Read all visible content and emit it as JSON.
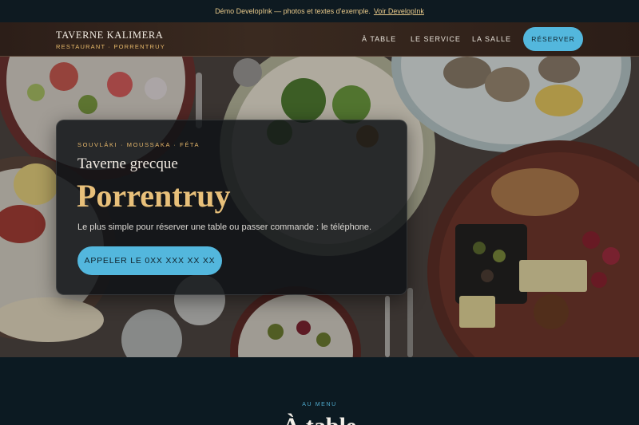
{
  "demo_bar": {
    "text": "Démo DevelopInk — photos et textes d'exemple.",
    "link": "Voir DevelopInk"
  },
  "brand": {
    "name": "TAVERNE KALIMERA",
    "subtitle": "RESTAURANT · PORRENTRUY"
  },
  "nav": {
    "items": [
      {
        "label": "À TABLE"
      },
      {
        "label": "LE SERVICE"
      },
      {
        "label": "LA SALLE"
      }
    ],
    "cta": "RÉSERVER"
  },
  "hero": {
    "kicker": "SOUVLÁKI · MOUSSAKA · FÉTA",
    "subtitle": "Taverne grecque",
    "title": "Porrentruy",
    "lead": "Le plus simple pour réserver une table ou passer commande : le téléphone.",
    "cta": "APPELER LE 0XX XXX XX XX"
  },
  "menu_section": {
    "kicker": "AU MENU",
    "title": "À table"
  },
  "colors": {
    "accent": "#53b7dd",
    "gold": "#e8c07a",
    "background": "#0b1820"
  }
}
